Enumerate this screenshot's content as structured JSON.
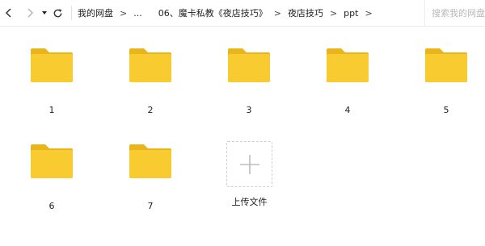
{
  "toolbar": {
    "back_icon": "chevron-left-icon",
    "forward_icon": "chevron-right-icon",
    "dropdown_icon": "caret-down-icon",
    "refresh_icon": "refresh-icon"
  },
  "breadcrumb": {
    "items": [
      "我的网盘",
      "...",
      "06、魔卡私教《夜店技巧》",
      "夜店技巧",
      "ppt"
    ],
    "separator": ">"
  },
  "search": {
    "placeholder": "搜索我的网盘"
  },
  "folders": [
    {
      "name": "1"
    },
    {
      "name": "2"
    },
    {
      "name": "3"
    },
    {
      "name": "4"
    },
    {
      "name": "5"
    },
    {
      "name": "6"
    },
    {
      "name": "7"
    }
  ],
  "upload": {
    "label": "上传文件",
    "icon": "plus-icon"
  },
  "colors": {
    "folder_body": "#f8cc31",
    "folder_tab": "#eebb1f",
    "folder_back": "#e9b51a"
  }
}
